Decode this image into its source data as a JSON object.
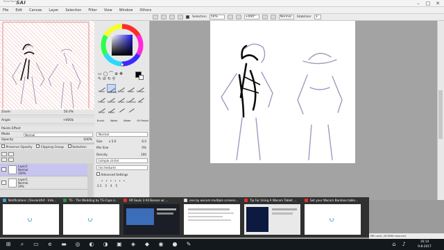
{
  "app": {
    "logo_text": "SAI",
    "logo_sub": "PaintTool"
  },
  "window_controls": {
    "minimize": "–",
    "maximize": "□",
    "close": "✕"
  },
  "menu": [
    "File",
    "Edit",
    "Canvas",
    "Layer",
    "Selection",
    "Filter",
    "View",
    "Window",
    "Others"
  ],
  "toolbar": {
    "selection_label": "Selection",
    "zoom_value": "50%",
    "rotation_value": "+000°",
    "blend_mode": "Normal",
    "stabilizer_label": "Stabilizer",
    "stabilizer_value": "3"
  },
  "navigator_panel": {
    "zoom_label": "Zoom",
    "zoom_value": "50.0%",
    "angle_label": "Angle",
    "angle_value": "+000$"
  },
  "layer_panel": {
    "paints_effect_label": "Paints Effect",
    "mode_label": "Mode",
    "mode_value": "Normal",
    "opacity_label": "Opacity",
    "opacity_value": "100%",
    "preserve_opacity_label": "Preserve Opacity",
    "clipping_group_label": "Clipping Group",
    "selection_source_label": "Selection Source",
    "layers": [
      {
        "name": "Layer2",
        "mode": "Normal",
        "opacity": "100%",
        "selected": true
      },
      {
        "name": "Layer1",
        "mode": "Normal",
        "opacity": "29%",
        "selected": false
      }
    ]
  },
  "tools": {
    "rows": [
      [
        "Pencil",
        "AirBrush",
        "Brush",
        "Water"
      ],
      [
        "Marker",
        "Eraser",
        "Bucket",
        "Select"
      ],
      [
        "Deselect",
        "Blur",
        "Brush",
        "Water"
      ]
    ],
    "sub_labels": [
      "Brush",
      "Water",
      "Water",
      "Oil Pastel"
    ],
    "blend_mode": "Normal",
    "size_label": "Size",
    "size_mult": "x 5.0",
    "size_value": "6.0",
    "min_size_label": "Min Size",
    "min_size_value": "0%",
    "density_label": "Density",
    "density_value": "100",
    "shape_value": "(simple circle)",
    "texture_value": "(no texture)",
    "advanced_settings_label": "Advanced Settings",
    "brush_sizes": [
      "2.3",
      "3",
      "4",
      "5"
    ]
  },
  "task_switcher": {
    "cards": [
      {
        "title": "Notifications | DeviantArt - Inte...",
        "icon_color": "#44a0d0"
      },
      {
        "title": "TG - The Wedding by TG-Caps o...",
        "icon_color": "#2f8f4e"
      },
      {
        "title": "VR Souls 3 All Bosses w/ ...",
        "icon_color": "#e0312b"
      },
      {
        "title": "one by wacom multiple screens...",
        "icon_color": "#dcdcdc"
      },
      {
        "title": "Tip For Using A Wacom Tablet ...",
        "icon_color": "#e0312b"
      },
      {
        "title": "Set your Wacom Bamboo table...",
        "icon_color": "#e0312b"
      }
    ]
  },
  "status_bar": {
    "text": "MB used | 803MB reserved"
  },
  "clock": {
    "time": "16:14",
    "date": "9-8-2017"
  }
}
